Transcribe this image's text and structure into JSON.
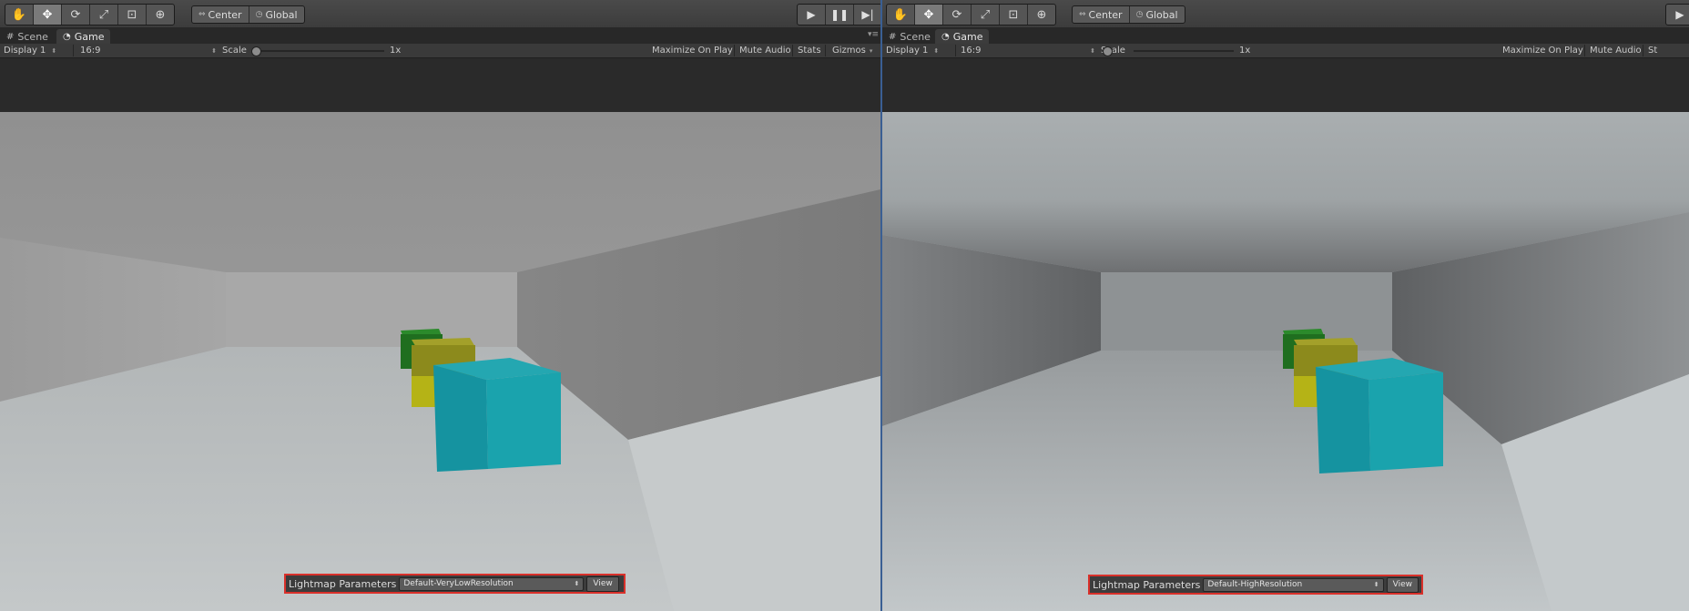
{
  "icons": {
    "hand": "hand-icon",
    "move": "move-icon",
    "rotate": "rotate-icon",
    "scale": "scale-icon",
    "rect": "rect-tool-icon",
    "transform": "transform-tool-icon",
    "play": "play-icon",
    "pause": "pause-icon",
    "step": "step-icon"
  },
  "colors": {
    "highlight_border": "#d9302a",
    "cube_cyan": "#1aa3ad",
    "cube_olive": "#8c8a1c",
    "cube_green": "#1f6e1f",
    "cube_yellow": "#b5b316",
    "pane_divider": "#3a5f93"
  },
  "left": {
    "pivot": {
      "center": "Center",
      "global": "Global"
    },
    "tabs": [
      {
        "label": "Scene"
      },
      {
        "label": "Game"
      }
    ],
    "gamebar": {
      "display": "Display 1",
      "aspect": "16:9",
      "scale_label": "Scale",
      "scale_value": "1x",
      "maximize": "Maximize On Play",
      "mute": "Mute Audio",
      "stats": "Stats",
      "gizmos": "Gizmos"
    },
    "lightmap": {
      "label": "Lightmap Parameters",
      "value": "Default-VeryLowResolution",
      "view": "View"
    }
  },
  "right": {
    "pivot": {
      "center": "Center",
      "global": "Global"
    },
    "tabs": [
      {
        "label": "Scene"
      },
      {
        "label": "Game"
      }
    ],
    "gamebar": {
      "display": "Display 1",
      "aspect": "16:9",
      "scale_label": "Scale",
      "scale_value": "1x",
      "maximize": "Maximize On Play",
      "mute": "Mute Audio",
      "stats_cut": "St"
    },
    "lightmap": {
      "label": "Lightmap Parameters",
      "value": "Default-HighResolution",
      "view": "View"
    }
  }
}
